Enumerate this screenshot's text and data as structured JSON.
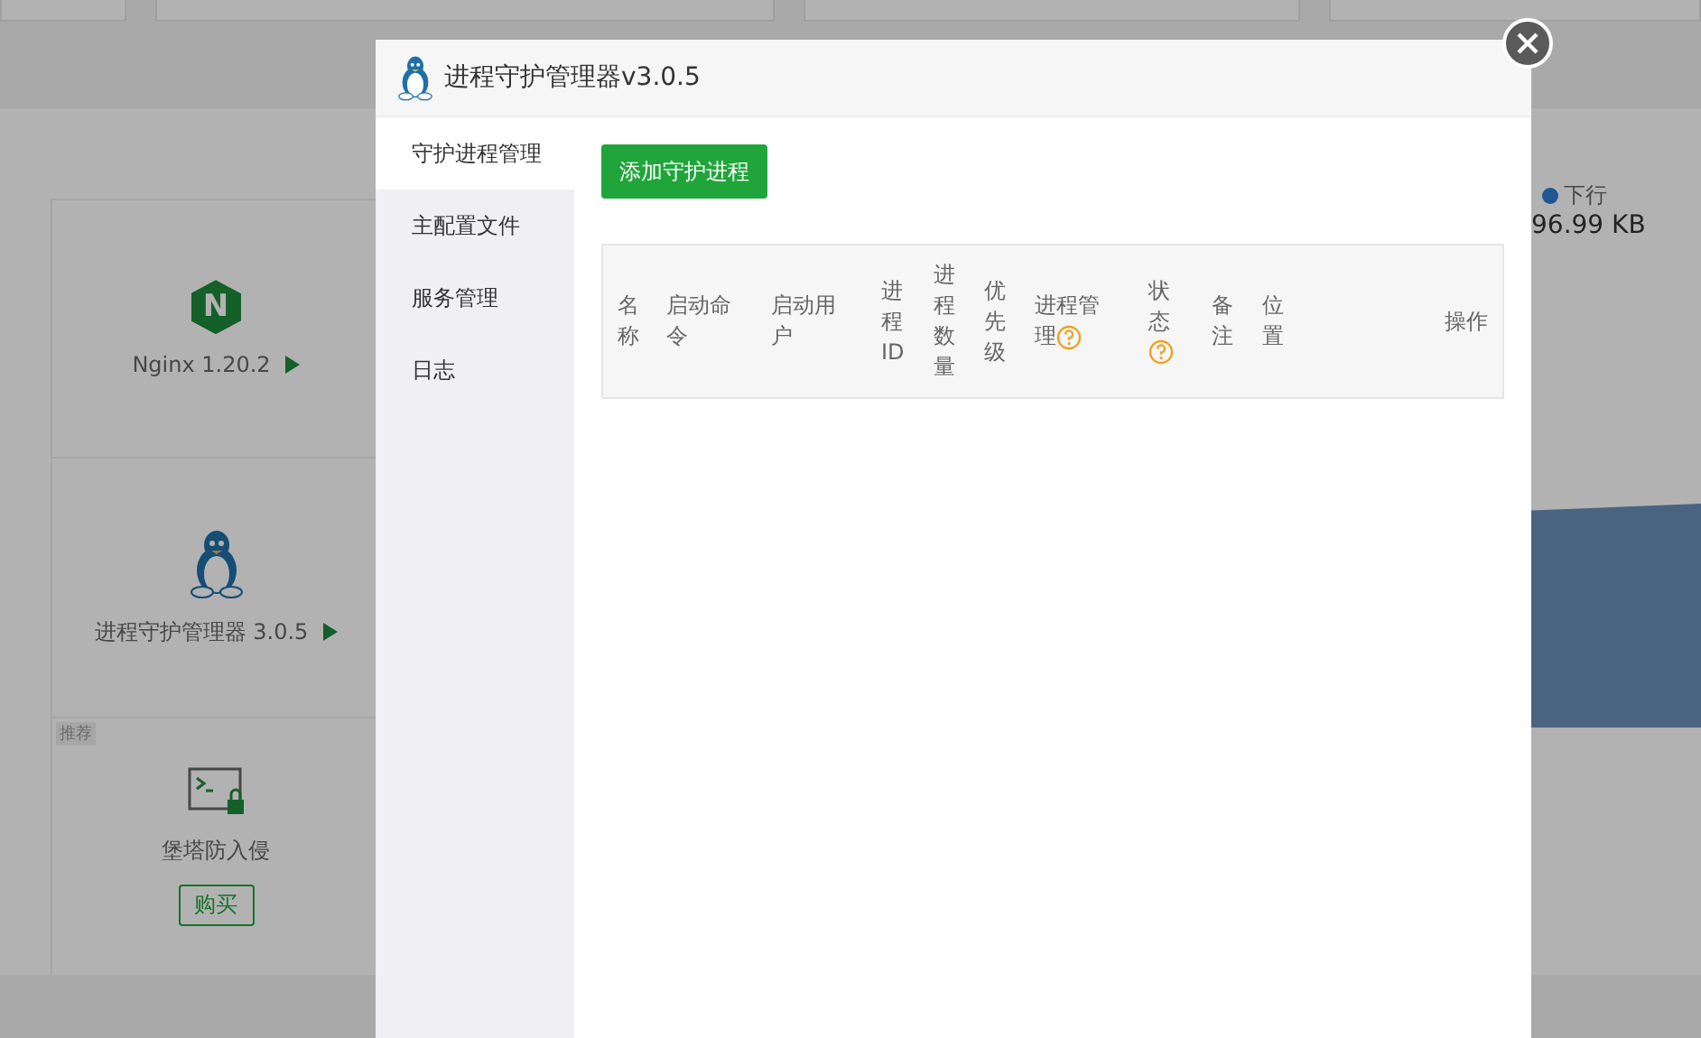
{
  "background": {
    "apps": [
      {
        "kind": "nginx",
        "logo_letter": "N",
        "label": "Nginx 1.20.2"
      },
      {
        "kind": "penguin",
        "label": "进程守护管理器 3.0.5"
      },
      {
        "kind": "terminal",
        "label": "堡塔防入侵",
        "tag": "推荐",
        "action": "购买"
      }
    ],
    "traffic": {
      "legend": "下行",
      "value": "96.99 KB"
    }
  },
  "dialog": {
    "title": "进程守护管理器v3.0.5",
    "sidebar": [
      {
        "label": "守护进程管理",
        "selected": true
      },
      {
        "label": "主配置文件",
        "selected": false
      },
      {
        "label": "服务管理",
        "selected": false
      },
      {
        "label": "日志",
        "selected": false
      }
    ],
    "add_button": "添加守护进程",
    "table": {
      "columns": [
        {
          "label": "名称",
          "help": false
        },
        {
          "label": "启动命令",
          "help": false
        },
        {
          "label": "启动用户",
          "help": false
        },
        {
          "label": "进程ID",
          "help": false
        },
        {
          "label": "进程数量",
          "help": false
        },
        {
          "label": "优先级",
          "help": false
        },
        {
          "label": "进程管理",
          "help": true
        },
        {
          "label": "状态",
          "help": true
        },
        {
          "label": "备注",
          "help": false
        },
        {
          "label": "位置",
          "help": false
        },
        {
          "label": "操作",
          "help": false
        }
      ]
    }
  }
}
